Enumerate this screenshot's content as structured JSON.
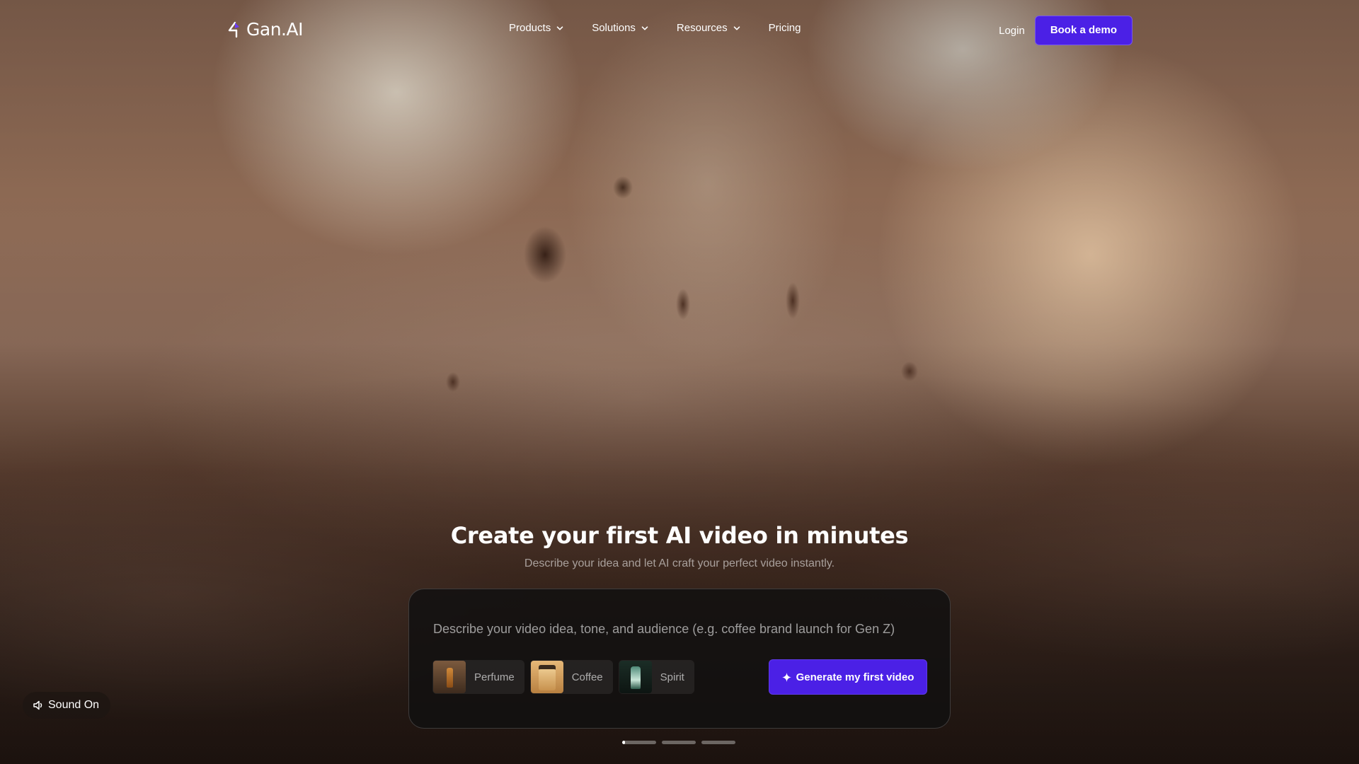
{
  "brand": {
    "name": "Gan.AI",
    "accent_color": "#4b20e6"
  },
  "nav": {
    "items": [
      {
        "label": "Products",
        "has_dropdown": true
      },
      {
        "label": "Solutions",
        "has_dropdown": true
      },
      {
        "label": "Resources",
        "has_dropdown": true
      },
      {
        "label": "Pricing",
        "has_dropdown": false
      }
    ],
    "login_label": "Login",
    "demo_label": "Book a demo"
  },
  "hero": {
    "title": "Create your first AI video in minutes",
    "subtitle": "Describe your idea and let AI craft your perfect video instantly."
  },
  "prompt": {
    "placeholder": "Describe your video idea, tone, and audience (e.g. coffee brand launch for Gen Z)",
    "value": "",
    "presets": [
      {
        "label": "Perfume",
        "thumb_icon": "perfume-bottle-thumbnail"
      },
      {
        "label": "Coffee",
        "thumb_icon": "coffee-bag-thumbnail"
      },
      {
        "label": "Spirit",
        "thumb_icon": "spirit-bottle-thumbnail"
      }
    ],
    "generate_label": "Generate my first video",
    "generate_icon": "sparkle-icon"
  },
  "carousel": {
    "slides": 3,
    "active_index": 0,
    "active_progress": 0.08
  },
  "sound": {
    "label": "Sound On",
    "icon": "speaker-icon"
  }
}
